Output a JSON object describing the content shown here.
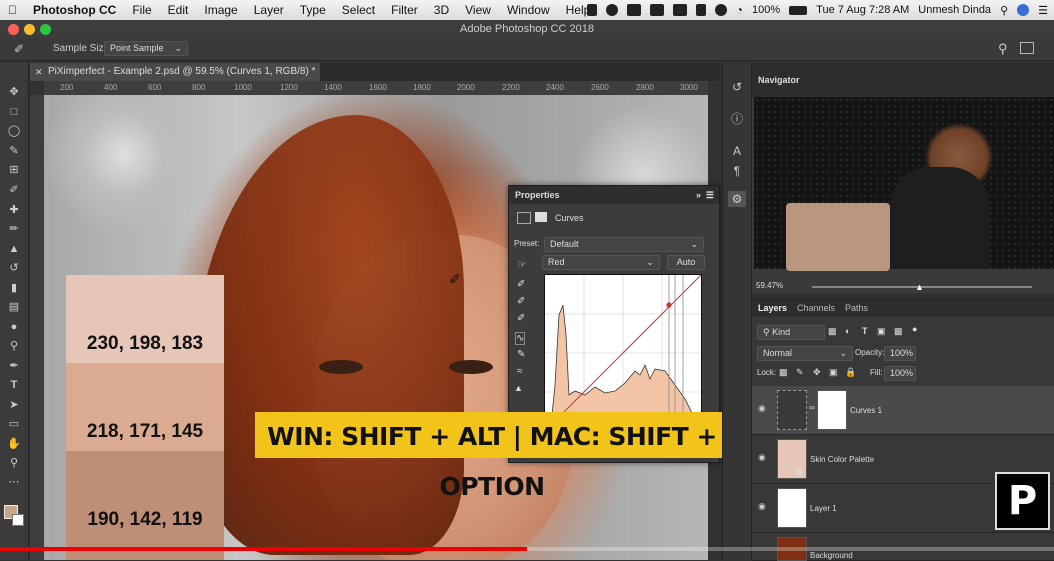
{
  "menubar": {
    "app": "Photoshop CC",
    "items": [
      "File",
      "Edit",
      "Image",
      "Layer",
      "Type",
      "Select",
      "Filter",
      "3D",
      "View",
      "Window",
      "Help"
    ],
    "battery": "100%",
    "datetime": "Tue 7 Aug  7:28 AM",
    "user": "Unmesh Dinda"
  },
  "window": {
    "title": "Adobe Photoshop CC 2018"
  },
  "options": {
    "sample_size_label": "Sample Size:",
    "sample_size_value": "Point Sample"
  },
  "document": {
    "tab_title": "PiXimperfect - Example 2.psd @ 59.5% (Curves 1, RGB/8) *"
  },
  "ruler": {
    "h_ticks": [
      "200",
      "400",
      "600",
      "800",
      "1000",
      "1200",
      "1400",
      "1600",
      "1800",
      "2000",
      "2200",
      "2400",
      "2600",
      "2800",
      "3000"
    ]
  },
  "swatches": [
    {
      "label": "230, 198, 183",
      "color": "#e6c6b7"
    },
    {
      "label": "218, 171, 145",
      "color": "#daab91"
    },
    {
      "label": "190, 142, 119",
      "color": "#be8e77"
    }
  ],
  "banner": {
    "text": "WIN: SHIFT + ALT  |  MAC: SHIFT + OPTION"
  },
  "properties": {
    "title": "Properties",
    "type": "Curves",
    "preset_label": "Preset:",
    "preset_value": "Default",
    "channel": "Red",
    "auto_label": "Auto"
  },
  "navigator": {
    "title": "Navigator",
    "zoom": "59.47%"
  },
  "layers": {
    "tabs": [
      "Layers",
      "Channels",
      "Paths"
    ],
    "kind": "Kind",
    "blend_mode": "Normal",
    "opacity_label": "Opacity:",
    "opacity_value": "100%",
    "lock_label": "Lock:",
    "fill_label": "Fill:",
    "fill_value": "100%",
    "items": [
      {
        "name": "Curves 1"
      },
      {
        "name": "Skin Color Palette"
      },
      {
        "name": "Layer 1"
      },
      {
        "name": "Background"
      }
    ]
  },
  "video": {
    "progress": 0.5
  }
}
